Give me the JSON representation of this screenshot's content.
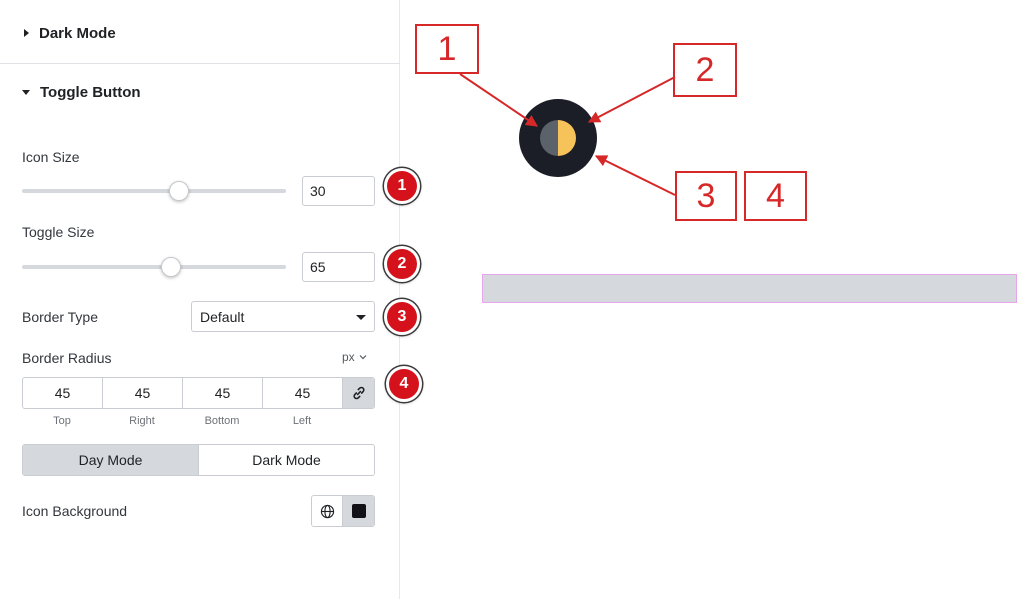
{
  "panel": {
    "dark_mode_section": "Dark Mode",
    "toggle_button_section": "Toggle Button",
    "icon_size": {
      "label": "Icon Size",
      "value": "30",
      "slider_fraction": 0.6
    },
    "toggle_size": {
      "label": "Toggle Size",
      "value": "65",
      "slider_fraction": 0.57
    },
    "border_type": {
      "label": "Border Type",
      "selected": "Default"
    },
    "border_radius": {
      "label": "Border Radius",
      "unit": "px",
      "values": {
        "top": "45",
        "right": "45",
        "bottom": "45",
        "left": "45"
      },
      "labels": {
        "top": "Top",
        "right": "Right",
        "bottom": "Bottom",
        "left": "Left"
      }
    },
    "mode_tabs": {
      "day": "Day Mode",
      "dark": "Dark Mode",
      "active": "day"
    },
    "icon_background": {
      "label": "Icon Background",
      "swatch_color": "#111116"
    }
  },
  "badges": [
    "1",
    "2",
    "3",
    "4"
  ],
  "callouts": [
    "1",
    "2",
    "3",
    "4"
  ],
  "colors": {
    "annotation_red": "#d62828",
    "badge_red": "#d5121b",
    "toggle_bg": "#1b1d27",
    "moon_dark": "#5b6269",
    "moon_light": "#f6c35b",
    "preview_border": "#e7a6ea"
  }
}
